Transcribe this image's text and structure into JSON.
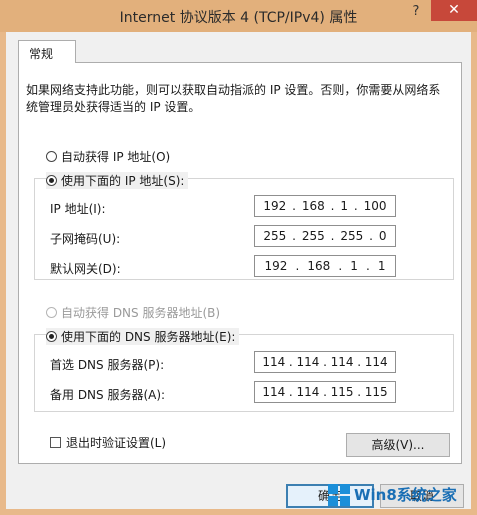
{
  "window": {
    "title": "Internet 协议版本 4 (TCP/IPv4) 属性",
    "help_label": "?",
    "close_label": "✕"
  },
  "tabs": [
    {
      "label": "常规"
    }
  ],
  "description": "如果网络支持此功能，则可以获取自动指派的 IP 设置。否则，你需要从网络系统管理员处获得适当的 IP 设置。",
  "ip": {
    "auto_label": "自动获得 IP 地址(O)",
    "manual_label": "使用下面的 IP 地址(S):",
    "address_label": "IP 地址(I):",
    "address": [
      "192",
      "168",
      "1",
      "100"
    ],
    "mask_label": "子网掩码(U):",
    "mask": [
      "255",
      "255",
      "255",
      "0"
    ],
    "gateway_label": "默认网关(D):",
    "gateway": [
      "192",
      "168",
      "1",
      "1"
    ]
  },
  "dns": {
    "auto_label": "自动获得 DNS 服务器地址(B)",
    "manual_label": "使用下面的 DNS 服务器地址(E):",
    "preferred_label": "首选 DNS 服务器(P):",
    "preferred": [
      "114",
      "114",
      "114",
      "114"
    ],
    "alternate_label": "备用 DNS 服务器(A):",
    "alternate": [
      "114",
      "114",
      "115",
      "115"
    ]
  },
  "validate_label": "退出时验证设置(L)",
  "advanced_label": "高级(V)...",
  "ok_label": "确定",
  "cancel_label": "取消",
  "watermark": {
    "text": "Win8系统之家"
  }
}
